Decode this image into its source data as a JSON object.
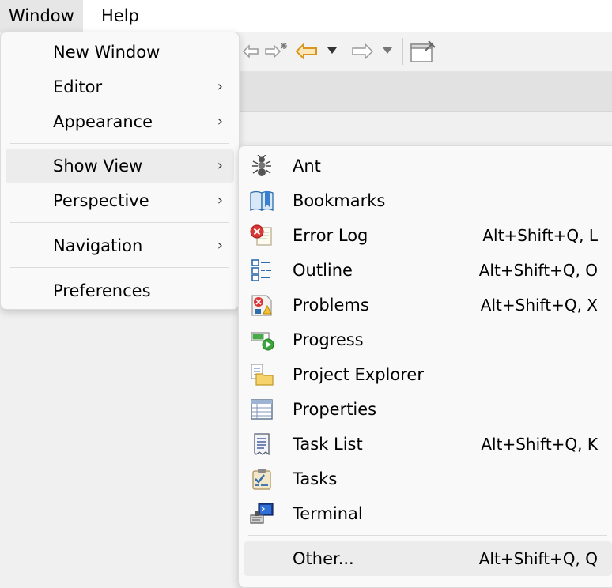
{
  "menubar": {
    "window": "Window",
    "help": "Help"
  },
  "window_menu": {
    "items": [
      {
        "label": "New Window"
      },
      {
        "label": "Editor",
        "arrow": "›"
      },
      {
        "label": "Appearance",
        "arrow": "›"
      },
      {
        "label": "Show View",
        "arrow": "›"
      },
      {
        "label": "Perspective",
        "arrow": "›"
      },
      {
        "label": "Navigation",
        "arrow": "›"
      },
      {
        "label": "Preferences"
      }
    ]
  },
  "show_view_menu": {
    "items": [
      {
        "label": "Ant",
        "shortcut": "",
        "icon": "ant-icon"
      },
      {
        "label": "Bookmarks",
        "shortcut": "",
        "icon": "bookmarks-icon"
      },
      {
        "label": "Error Log",
        "shortcut": "Alt+Shift+Q, L",
        "icon": "error-log-icon"
      },
      {
        "label": "Outline",
        "shortcut": "Alt+Shift+Q, O",
        "icon": "outline-icon"
      },
      {
        "label": "Problems",
        "shortcut": "Alt+Shift+Q, X",
        "icon": "problems-icon"
      },
      {
        "label": "Progress",
        "shortcut": "",
        "icon": "progress-icon"
      },
      {
        "label": "Project Explorer",
        "shortcut": "",
        "icon": "project-explorer-icon"
      },
      {
        "label": "Properties",
        "shortcut": "",
        "icon": "properties-icon"
      },
      {
        "label": "Task List",
        "shortcut": "Alt+Shift+Q, K",
        "icon": "task-list-icon"
      },
      {
        "label": "Tasks",
        "shortcut": "",
        "icon": "tasks-icon"
      },
      {
        "label": "Terminal",
        "shortcut": "",
        "icon": "terminal-icon"
      },
      {
        "label": "Other...",
        "shortcut": "Alt+Shift+Q, Q",
        "icon": ""
      }
    ]
  },
  "colors": {
    "menu_bg": "#f9f9f9",
    "hover_bg": "#ececec",
    "back_arrow": "#e8a33a"
  }
}
